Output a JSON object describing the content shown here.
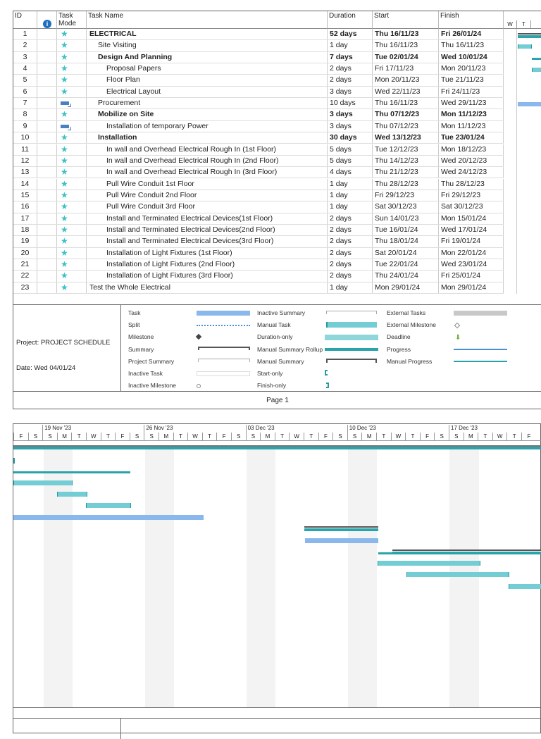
{
  "columns": {
    "id": "ID",
    "mode_l1": "Task",
    "mode_l2": "Mode",
    "name": "Task Name",
    "duration": "Duration",
    "start": "Start",
    "finish": "Finish",
    "gantt_days": [
      "W",
      "T"
    ]
  },
  "tasks": [
    {
      "id": "1",
      "mode": "manual",
      "name": "ELECTRICAL",
      "duration": "52 days",
      "start": "Thu 16/11/23",
      "finish": "Fri 26/01/24",
      "level": 0,
      "bold": true
    },
    {
      "id": "2",
      "mode": "manual",
      "name": "Site Visiting",
      "duration": "1 day",
      "start": "Thu 16/11/23",
      "finish": "Thu 16/11/23",
      "level": 1,
      "bold": false
    },
    {
      "id": "3",
      "mode": "manual",
      "name": "Design And Planning",
      "duration": "7 days",
      "start": "Tue 02/01/24",
      "finish": "Wed 10/01/24",
      "level": 1,
      "bold": true
    },
    {
      "id": "4",
      "mode": "manual",
      "name": "Proposal Papers",
      "duration": "2 days",
      "start": "Fri 17/11/23",
      "finish": "Mon 20/11/23",
      "level": 2,
      "bold": false
    },
    {
      "id": "5",
      "mode": "manual",
      "name": "Floor Plan",
      "duration": "2 days",
      "start": "Mon 20/11/23",
      "finish": "Tue 21/11/23",
      "level": 2,
      "bold": false
    },
    {
      "id": "6",
      "mode": "manual",
      "name": "Electrical Layout",
      "duration": "3 days",
      "start": "Wed 22/11/23",
      "finish": "Fri 24/11/23",
      "level": 2,
      "bold": false
    },
    {
      "id": "7",
      "mode": "auto",
      "name": "Procurement",
      "duration": "10 days",
      "start": "Thu 16/11/23",
      "finish": "Wed 29/11/23",
      "level": 1,
      "bold": false
    },
    {
      "id": "8",
      "mode": "manual",
      "name": "Mobilize on Site",
      "duration": "3 days",
      "start": "Thu 07/12/23",
      "finish": "Mon 11/12/23",
      "level": 1,
      "bold": true
    },
    {
      "id": "9",
      "mode": "auto",
      "name": "Installation of temporary Power",
      "duration": "3 days",
      "start": "Thu 07/12/23",
      "finish": "Mon 11/12/23",
      "level": 2,
      "bold": false
    },
    {
      "id": "10",
      "mode": "manual",
      "name": "Installation",
      "duration": "30 days",
      "start": "Wed 13/12/23",
      "finish": "Tue 23/01/24",
      "level": 1,
      "bold": true
    },
    {
      "id": "11",
      "mode": "manual",
      "name": "In wall and Overhead Electrical Rough In (1st Floor)",
      "duration": "5 days",
      "start": "Tue 12/12/23",
      "finish": "Mon 18/12/23",
      "level": 2,
      "bold": false
    },
    {
      "id": "12",
      "mode": "manual",
      "name": "In wall and Overhead Electrical Rough In (2nd Floor)",
      "duration": "5 days",
      "start": "Thu 14/12/23",
      "finish": "Wed 20/12/23",
      "level": 2,
      "bold": false
    },
    {
      "id": "13",
      "mode": "manual",
      "name": "In wall and Overhead Electrical Rough In (3rd Floor)",
      "duration": "4 days",
      "start": "Thu 21/12/23",
      "finish": "Wed 24/12/23",
      "level": 2,
      "bold": false
    },
    {
      "id": "14",
      "mode": "manual",
      "name": "Pull Wire Conduit 1st Floor",
      "duration": "1 day",
      "start": "Thu 28/12/23",
      "finish": "Thu 28/12/23",
      "level": 2,
      "bold": false
    },
    {
      "id": "15",
      "mode": "manual",
      "name": "Pull Wire Conduit 2nd Floor",
      "duration": "1 day",
      "start": "Fri 29/12/23",
      "finish": "Fri 29/12/23",
      "level": 2,
      "bold": false
    },
    {
      "id": "16",
      "mode": "manual",
      "name": "Pull Wire Conduit 3rd Floor",
      "duration": "1 day",
      "start": "Sat 30/12/23",
      "finish": "Sat 30/12/23",
      "level": 2,
      "bold": false
    },
    {
      "id": "17",
      "mode": "manual",
      "name": "Install and Terminated Electrical Devices(1st Floor)",
      "duration": "2 days",
      "start": "Sun 14/01/23",
      "finish": "Mon 15/01/24",
      "level": 2,
      "bold": false
    },
    {
      "id": "18",
      "mode": "manual",
      "name": "Install and Terminated Electrical Devices(2nd Floor)",
      "duration": "2 days",
      "start": "Tue 16/01/24",
      "finish": "Wed 17/01/24",
      "level": 2,
      "bold": false
    },
    {
      "id": "19",
      "mode": "manual",
      "name": "Install and Terminated Electrical Devices(3rd Floor)",
      "duration": "2 days",
      "start": "Thu 18/01/24",
      "finish": "Fri 19/01/24",
      "level": 2,
      "bold": false
    },
    {
      "id": "20",
      "mode": "manual",
      "name": "Installation of Light Fixtures (1st Floor)",
      "duration": "2 days",
      "start": "Sat 20/01/24",
      "finish": "Mon 22/01/24",
      "level": 2,
      "bold": false
    },
    {
      "id": "21",
      "mode": "manual",
      "name": "Installation of Light Fixtures (2nd Floor)",
      "duration": "2 days",
      "start": "Tue 22/01/24",
      "finish": "Wed 23/01/24",
      "level": 2,
      "bold": false
    },
    {
      "id": "22",
      "mode": "manual",
      "name": "Installation of Light Fixtures (3rd Floor)",
      "duration": "2 days",
      "start": "Thu 24/01/24",
      "finish": "Fri 25/01/24",
      "level": 2,
      "bold": false
    },
    {
      "id": "23",
      "mode": "manual",
      "name": "Test the Whole Electrical",
      "duration": "1 day",
      "start": "Mon 29/01/24",
      "finish": "Mon 29/01/24",
      "level": 0,
      "bold": false
    }
  ],
  "project": {
    "label": "Project: PROJECT SCHEDULE",
    "date": "Date: Wed 04/01/24"
  },
  "legend": {
    "col1": [
      "Task",
      "Split",
      "Milestone",
      "Summary",
      "Project Summary",
      "Inactive Task",
      "Inactive Milestone"
    ],
    "col2": [
      "Inactive Summary",
      "Manual Task",
      "Duration-only",
      "Manual Summary Rollup",
      "Manual Summary",
      "Start-only",
      "Finish-only"
    ],
    "col3": [
      "External Tasks",
      "External Milestone",
      "Deadline",
      "Progress",
      "Manual Progress"
    ]
  },
  "footer": {
    "page": "Page 1"
  },
  "timeline": {
    "weeks": [
      "19 Nov '23",
      "26 Nov '23",
      "03 Dec '23",
      "10 Dec '23",
      "17 Dec '23"
    ],
    "days": [
      "F",
      "S",
      "S",
      "M",
      "T",
      "W",
      "T",
      "F",
      "S",
      "S",
      "M",
      "T",
      "W",
      "T",
      "F",
      "S",
      "S",
      "M",
      "T",
      "W",
      "T",
      "F",
      "S",
      "S",
      "M",
      "T",
      "W",
      "T",
      "F",
      "S",
      "S",
      "M",
      "T",
      "W",
      "T",
      "F"
    ]
  },
  "colors": {
    "task": "#8ab8ec",
    "manual": "#74cdd4",
    "rollup": "#2aa3aa",
    "summary": "#555555"
  }
}
